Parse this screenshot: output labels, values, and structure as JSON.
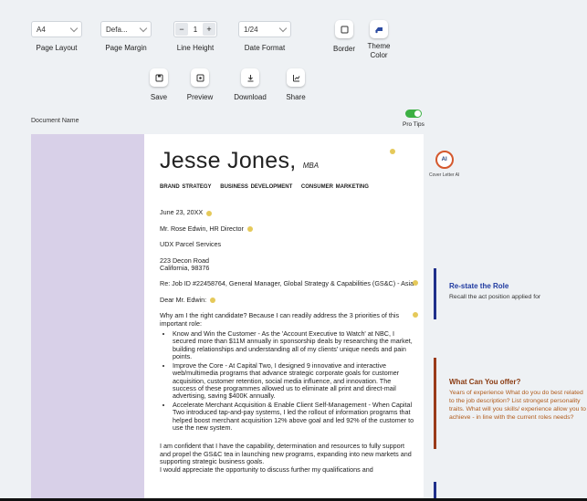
{
  "toolbar": {
    "page_layout": {
      "value": "A4",
      "label": "Page Layout"
    },
    "page_margin": {
      "value": "Defa...",
      "label": "Page Margin"
    },
    "line_height": {
      "value": "1",
      "minus": "−",
      "plus": "+",
      "label": "Line Height"
    },
    "date_format": {
      "value": "1/24",
      "label": "Date Format"
    },
    "border": {
      "label": "Border"
    },
    "theme_color": {
      "label_1": "Theme",
      "label_2": "Color"
    },
    "save": {
      "label": "Save"
    },
    "preview": {
      "label": "Preview"
    },
    "download": {
      "label": "Download"
    },
    "share": {
      "label": "Share"
    }
  },
  "document_name_label": "Document Name",
  "pro_tips": {
    "label": "Pro Tips",
    "enabled": true
  },
  "resume": {
    "name": "Jesse Jones,",
    "suffix": "MBA",
    "tags": [
      "BRAND STRATEGY",
      "BUSINESS DEVELOPMENT",
      "CONSUMER MARKETING"
    ],
    "date": "June 23, 20XX",
    "recipient": "Mr. Rose Edwin, HR Director",
    "company": "UDX Parcel Services",
    "address_1": "223 Decon Road",
    "address_2": "California, 98376",
    "re": "Re: Job ID #22458764, General Manager, Global Strategy & Capabilities (GS&C) - Asia",
    "salutation": "Dear Mr. Edwin:",
    "intro": "Why am I the right candidate? Because I can readily address the 3 priorities of this important role:",
    "bullets": [
      "Know and Win the Customer - As the 'Account Executive to Watch' at NBC, I secured more than $11M annually in sponsorship deals by researching the market, building relationships and understanding all of my clients' unique needs and pain points.",
      "Improve the Core - At Capital Two, I designed 9 innovative and interactive web/multimedia programs that advance strategic corporate goals for customer acquisition, customer retention, social media influence, and innovation. The success of these programmes allowed us to eliminate all print and direct-mail advertising, saving $400K annually.",
      "Accelerate Merchant Acquisition & Enable Client Self-Management - When Capital Two introduced tap-and-pay systems, I led the rollout of information programs that helped boost merchant acquisition 12% above goal and led 92% of the customer to use the new system."
    ],
    "closing_1": "I am confident that I have the capability, determination and resources to fully support and propel the GS&C tea in launching new programs, expanding into new markets and supporting strategic business goals.",
    "closing_2": "I would appreciate the opportunity to discuss further my qualifications and"
  },
  "cover_letter_ai": {
    "label": "Cover Letter AI",
    "icon_text": "AI"
  },
  "tips": [
    {
      "title": "Re-state the Role",
      "desc": "Recall the act position applied for"
    },
    {
      "title": "What Can You offer?",
      "desc": "Years of experience What do you do best related to the job description? List strongest personality traits. What will you skills/ experience allow you to achieve - in line with the current roles needs?"
    }
  ],
  "colors": {
    "sidebar": "#d8d0e8",
    "accent_blue": "#1f2f8a",
    "accent_brown": "#9a3a1a",
    "toggle_on": "#3cb043"
  }
}
